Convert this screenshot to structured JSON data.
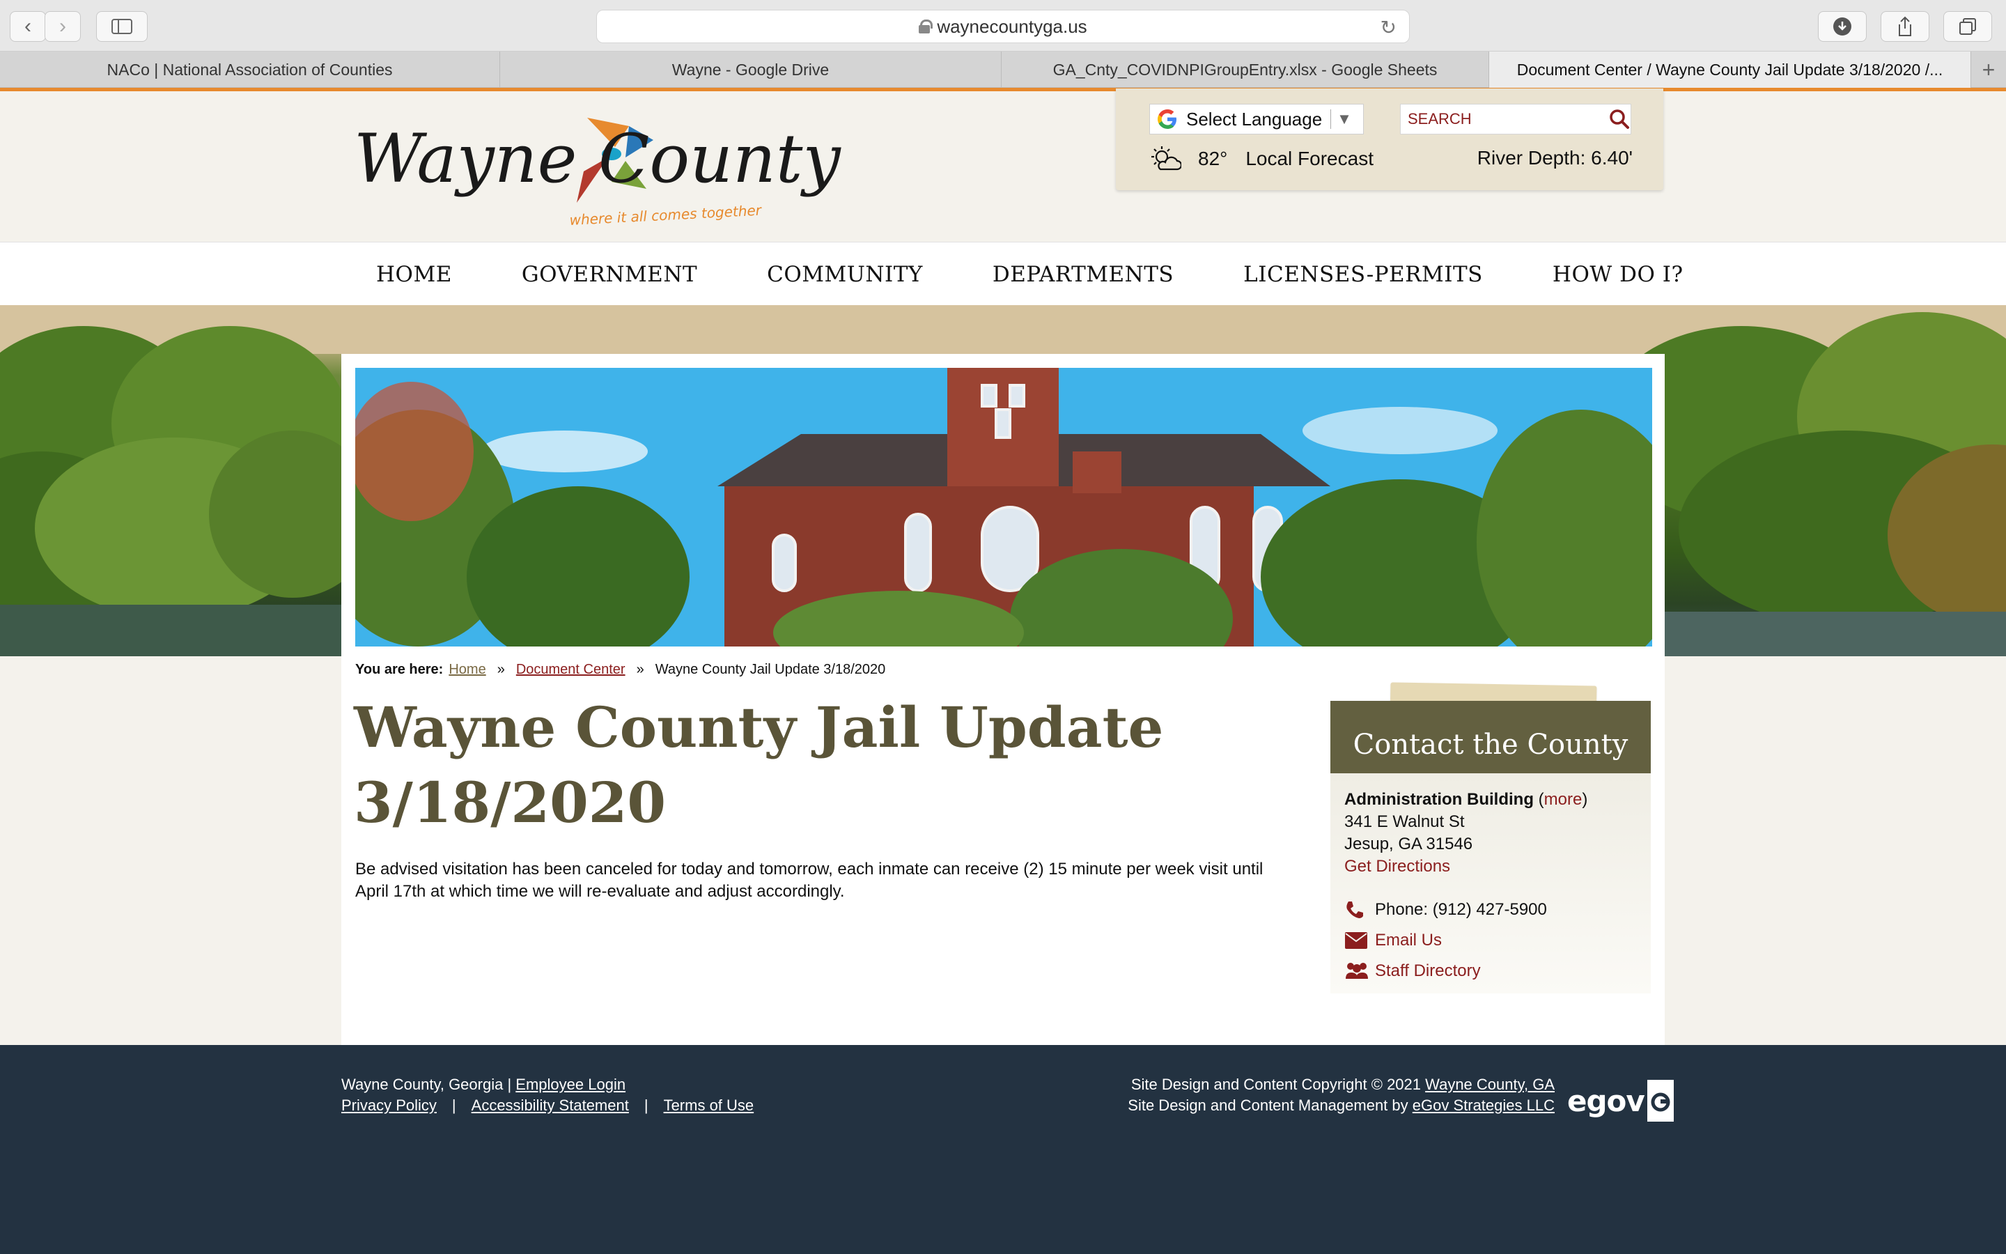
{
  "browser": {
    "url": "waynecountyga.us",
    "tabs": [
      {
        "label": "NACo | National Association of Counties",
        "active": false
      },
      {
        "label": "Wayne - Google Drive",
        "active": false
      },
      {
        "label": "GA_Cnty_COVIDNPIGroupEntry.xlsx - Google Sheets",
        "active": false
      },
      {
        "label": "Document Center / Wayne County Jail Update 3/18/2020 /...",
        "active": true
      }
    ]
  },
  "header": {
    "logo_text": "Wayne County",
    "logo_tagline": "where it all comes together",
    "language_label": "Select Language",
    "search_placeholder": "SEARCH",
    "temperature": "82°",
    "forecast_label": "Local Forecast",
    "river_depth": "River Depth: 6.40'"
  },
  "nav": {
    "items": [
      "HOME",
      "GOVERNMENT",
      "COMMUNITY",
      "DEPARTMENTS",
      "LICENSES-PERMITS",
      "HOW DO I?"
    ]
  },
  "breadcrumb": {
    "label": "You are here:",
    "home": "Home",
    "section": "Document Center",
    "current": "Wayne County Jail Update 3/18/2020"
  },
  "main": {
    "title": "Wayne County Jail Update 3/18/2020",
    "body": "Be advised visitation has been canceled for today and tomorrow, each inmate can receive (2) 15 minute per week visit until April 17th at which time we will re-evaluate and adjust accordingly."
  },
  "contact": {
    "heading": "Contact the County",
    "building": "Administration Building",
    "more": "more",
    "street": "341 E Walnut St",
    "city": "Jesup, GA 31546",
    "directions": "Get Directions",
    "phone": "Phone: (912) 427-5900",
    "email": "Email Us",
    "staff": "Staff Directory"
  },
  "footer": {
    "county": "Wayne County, Georgia |",
    "employee_login": "Employee Login",
    "privacy": "Privacy Policy",
    "accessibility": "Accessibility Statement",
    "terms": "Terms of Use",
    "copyright_prefix": "Site Design and Content Copyright © 2021",
    "copyright_link": "Wayne County, GA",
    "management_prefix": "Site Design and Content Management by",
    "management_link": "eGov Strategies LLC",
    "egov_logo": "egov"
  },
  "colors": {
    "accent_orange": "#e78a2e",
    "brand_olive": "#5a5438",
    "link_red": "#8b1e1e",
    "footer_navy": "#233241"
  }
}
